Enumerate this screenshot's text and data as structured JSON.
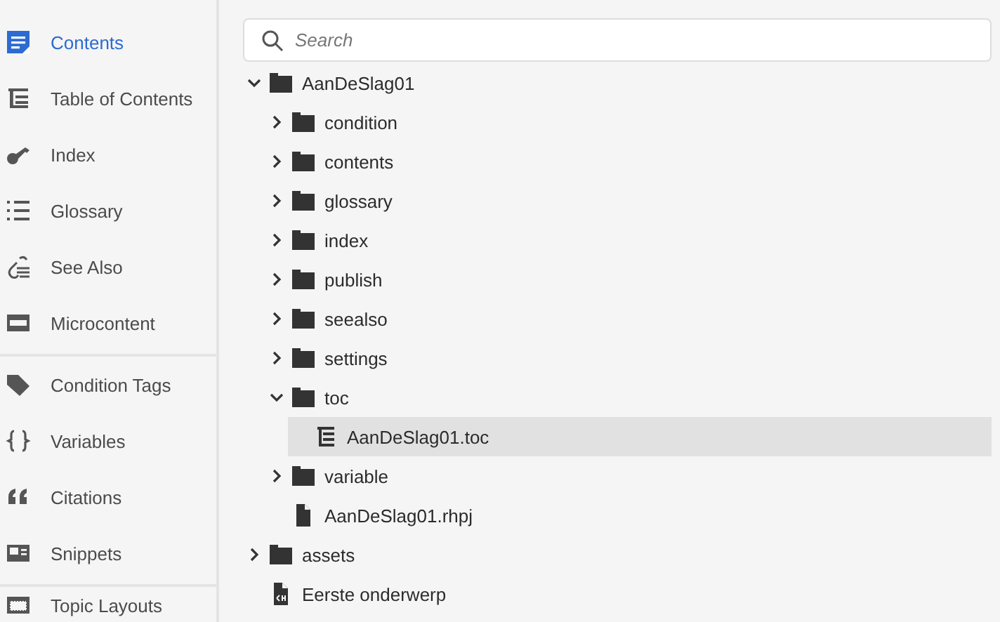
{
  "sidebar": {
    "groups": [
      [
        {
          "kind": "contents",
          "label": "Contents",
          "selected": true
        },
        {
          "kind": "toc",
          "label": "Table of Contents",
          "selected": false
        },
        {
          "kind": "index",
          "label": "Index",
          "selected": false
        },
        {
          "kind": "glossary",
          "label": "Glossary",
          "selected": false
        },
        {
          "kind": "seealso",
          "label": "See Also",
          "selected": false
        },
        {
          "kind": "microcontent",
          "label": "Microcontent",
          "selected": false
        }
      ],
      [
        {
          "kind": "tag",
          "label": "Condition Tags",
          "selected": false
        },
        {
          "kind": "variables",
          "label": "Variables",
          "selected": false
        },
        {
          "kind": "citations",
          "label": "Citations",
          "selected": false
        },
        {
          "kind": "snippets",
          "label": "Snippets",
          "selected": false
        }
      ],
      [
        {
          "kind": "layouts",
          "label": "Topic Layouts",
          "selected": false
        }
      ]
    ]
  },
  "search": {
    "placeholder": "Search"
  },
  "tree": [
    {
      "kind": "folder",
      "label": "AanDeSlag01",
      "expanded": true,
      "selected": false,
      "children": [
        {
          "kind": "folder",
          "label": "condition",
          "expanded": false,
          "selected": false
        },
        {
          "kind": "folder",
          "label": "contents",
          "expanded": false,
          "selected": false
        },
        {
          "kind": "folder",
          "label": "glossary",
          "expanded": false,
          "selected": false
        },
        {
          "kind": "folder",
          "label": "index",
          "expanded": false,
          "selected": false
        },
        {
          "kind": "folder",
          "label": "publish",
          "expanded": false,
          "selected": false
        },
        {
          "kind": "folder",
          "label": "seealso",
          "expanded": false,
          "selected": false
        },
        {
          "kind": "folder",
          "label": "settings",
          "expanded": false,
          "selected": false
        },
        {
          "kind": "folder",
          "label": "toc",
          "expanded": true,
          "selected": false,
          "children": [
            {
              "kind": "toc",
              "label": "AanDeSlag01.toc",
              "selected": true
            }
          ]
        },
        {
          "kind": "folder",
          "label": "variable",
          "expanded": false,
          "selected": false
        },
        {
          "kind": "file",
          "label": "AanDeSlag01.rhpj",
          "selected": false
        }
      ]
    },
    {
      "kind": "folder",
      "label": "assets",
      "expanded": false,
      "selected": false
    },
    {
      "kind": "topic",
      "label": "Eerste onderwerp",
      "selected": false
    }
  ]
}
